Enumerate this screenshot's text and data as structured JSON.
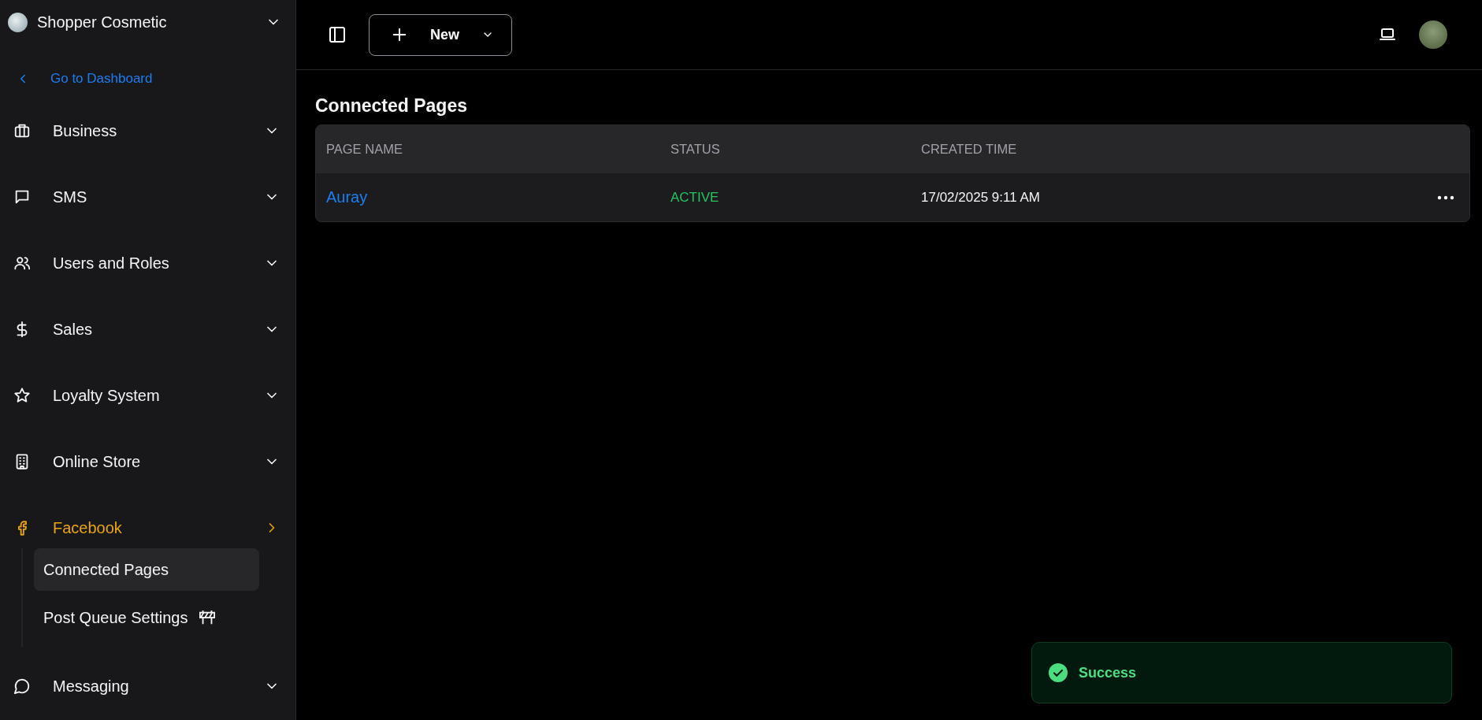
{
  "sidebar": {
    "workspace": "Shopper Cosmetic",
    "back_link": "Go to Dashboard",
    "items": [
      {
        "label": "Business",
        "active": false,
        "expanded": false
      },
      {
        "label": "SMS",
        "active": false,
        "expanded": false
      },
      {
        "label": "Users and Roles",
        "active": false,
        "expanded": false
      },
      {
        "label": "Sales",
        "active": false,
        "expanded": false
      },
      {
        "label": "Loyalty System",
        "active": false,
        "expanded": false
      },
      {
        "label": "Online Store",
        "active": false,
        "expanded": false
      },
      {
        "label": "Facebook",
        "active": true,
        "expanded": true,
        "children": [
          {
            "label": "Connected Pages",
            "selected": true,
            "under_construction": false
          },
          {
            "label": "Post Queue Settings",
            "selected": false,
            "under_construction": true
          }
        ]
      },
      {
        "label": "Messaging",
        "active": false,
        "expanded": false
      }
    ]
  },
  "header": {
    "new_button": "New"
  },
  "page_title": "Connected Pages",
  "table": {
    "columns": [
      "PAGE NAME",
      "STATUS",
      "CREATED TIME"
    ],
    "rows": [
      {
        "page_name": "Auray",
        "status": "ACTIVE",
        "status_active": true,
        "created_time": "17/02/2025 9:11 AM"
      }
    ]
  },
  "toast": {
    "kind": "success",
    "message": "Success"
  }
}
